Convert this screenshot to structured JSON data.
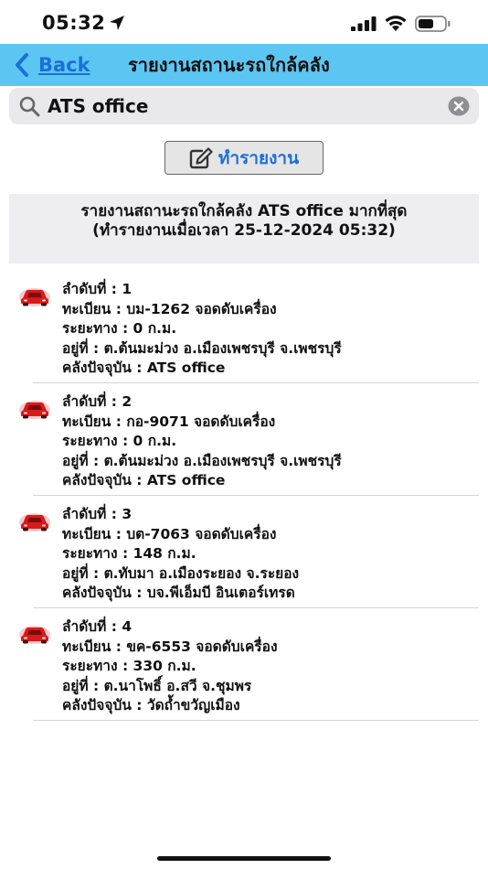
{
  "status_bar": {
    "time": "05:32"
  },
  "nav": {
    "back_label": "Back",
    "title": "รายงานสถานะรถใกล้คลัง"
  },
  "search": {
    "value": "ATS office"
  },
  "report_button": {
    "label": "ทำรายงาน"
  },
  "summary": {
    "line1": "รายงานสถานะรถใกล้คลัง ATS office มากที่สุด",
    "line2": "(ทำรายงานเมื่อเวลา 25-12-2024 05:32)"
  },
  "colors": {
    "nav_background": "#5cc6f2",
    "link_blue": "#1d6fd8",
    "car_red": "#d91a1a"
  },
  "icons": {
    "status": [
      "location-arrow-icon",
      "signal-icon",
      "wifi-icon",
      "battery-icon"
    ],
    "nav": "chevron-left-icon",
    "search": "search-icon",
    "clear": "clear-circle-icon",
    "report": "edit-icon",
    "item": "car-icon"
  },
  "items": [
    {
      "rank": "ลำดับที่ : 1",
      "plate": "ทะเบียน : บม-1262 จอดดับเครื่อง",
      "distance": "ระยะทาง : 0 ก.ม.",
      "address": "อยู่ที่ : ต.ต้นมะม่วง อ.เมืองเพชรบุรี จ.เพชรบุรี",
      "warehouse": "คลังปัจจุบัน : ATS office"
    },
    {
      "rank": "ลำดับที่ : 2",
      "plate": "ทะเบียน : กอ-9071 จอดดับเครื่อง",
      "distance": "ระยะทาง : 0 ก.ม.",
      "address": "อยู่ที่ : ต.ต้นมะม่วง อ.เมืองเพชรบุรี จ.เพชรบุรี",
      "warehouse": "คลังปัจจุบัน : ATS office"
    },
    {
      "rank": "ลำดับที่ : 3",
      "plate": "ทะเบียน : บต-7063 จอดดับเครื่อง",
      "distance": "ระยะทาง : 148 ก.ม.",
      "address": "อยู่ที่ : ต.ทับมา อ.เมืองระยอง จ.ระยอง",
      "warehouse": "คลังปัจจุบัน : บจ.พีเอ็มบี อินเตอร์เทรด"
    },
    {
      "rank": "ลำดับที่ : 4",
      "plate": "ทะเบียน : ขค-6553 จอดดับเครื่อง",
      "distance": "ระยะทาง : 330 ก.ม.",
      "address": "อยู่ที่ : ต.นาโพธิ์ อ.สวี จ.ชุมพร",
      "warehouse": "คลังปัจจุบัน : วัดถ้ำขวัญเมือง"
    }
  ]
}
